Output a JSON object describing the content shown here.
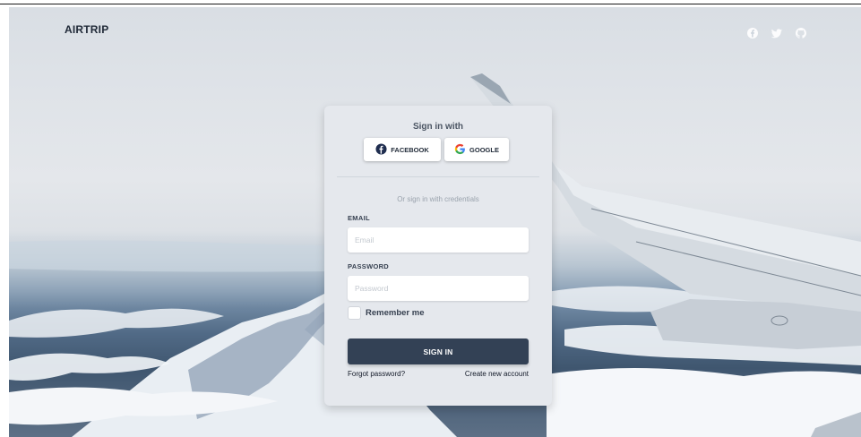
{
  "brand": {
    "name": "AIRTRIP"
  },
  "nav_icons": [
    "facebook-icon",
    "twitter-icon",
    "github-icon"
  ],
  "auth_card": {
    "heading": "Sign in with",
    "social_buttons": [
      {
        "label": "FACEBOOK",
        "icon": "facebook-icon"
      },
      {
        "label": "GOOGLE",
        "icon": "google-icon"
      }
    ],
    "or_text": "Or sign in with credentials",
    "email": {
      "label": "EMAIL",
      "placeholder": "Email",
      "value": ""
    },
    "password": {
      "label": "PASSWORD",
      "placeholder": "Password",
      "value": ""
    },
    "remember_label": "Remember me",
    "remember_checked": false,
    "submit_label": "SIGN IN",
    "forgot_label": "Forgot password?",
    "create_label": "Create new account"
  },
  "colors": {
    "card_bg": "#e5e8ed",
    "submit_bg": "#334155",
    "brand_text": "#1f2937",
    "facebook_blue": "#1f2d4f"
  }
}
